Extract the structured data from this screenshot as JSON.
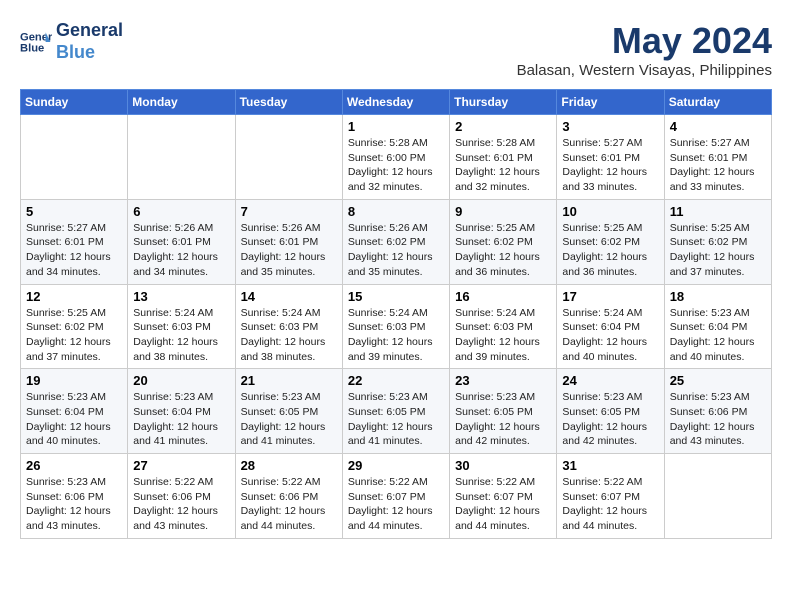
{
  "header": {
    "logo_line1": "General",
    "logo_line2": "Blue",
    "month_title": "May 2024",
    "location": "Balasan, Western Visayas, Philippines"
  },
  "days_of_week": [
    "Sunday",
    "Monday",
    "Tuesday",
    "Wednesday",
    "Thursday",
    "Friday",
    "Saturday"
  ],
  "weeks": [
    [
      {
        "day": "",
        "info": ""
      },
      {
        "day": "",
        "info": ""
      },
      {
        "day": "",
        "info": ""
      },
      {
        "day": "1",
        "info": "Sunrise: 5:28 AM\nSunset: 6:00 PM\nDaylight: 12 hours\nand 32 minutes."
      },
      {
        "day": "2",
        "info": "Sunrise: 5:28 AM\nSunset: 6:01 PM\nDaylight: 12 hours\nand 32 minutes."
      },
      {
        "day": "3",
        "info": "Sunrise: 5:27 AM\nSunset: 6:01 PM\nDaylight: 12 hours\nand 33 minutes."
      },
      {
        "day": "4",
        "info": "Sunrise: 5:27 AM\nSunset: 6:01 PM\nDaylight: 12 hours\nand 33 minutes."
      }
    ],
    [
      {
        "day": "5",
        "info": "Sunrise: 5:27 AM\nSunset: 6:01 PM\nDaylight: 12 hours\nand 34 minutes."
      },
      {
        "day": "6",
        "info": "Sunrise: 5:26 AM\nSunset: 6:01 PM\nDaylight: 12 hours\nand 34 minutes."
      },
      {
        "day": "7",
        "info": "Sunrise: 5:26 AM\nSunset: 6:01 PM\nDaylight: 12 hours\nand 35 minutes."
      },
      {
        "day": "8",
        "info": "Sunrise: 5:26 AM\nSunset: 6:02 PM\nDaylight: 12 hours\nand 35 minutes."
      },
      {
        "day": "9",
        "info": "Sunrise: 5:25 AM\nSunset: 6:02 PM\nDaylight: 12 hours\nand 36 minutes."
      },
      {
        "day": "10",
        "info": "Sunrise: 5:25 AM\nSunset: 6:02 PM\nDaylight: 12 hours\nand 36 minutes."
      },
      {
        "day": "11",
        "info": "Sunrise: 5:25 AM\nSunset: 6:02 PM\nDaylight: 12 hours\nand 37 minutes."
      }
    ],
    [
      {
        "day": "12",
        "info": "Sunrise: 5:25 AM\nSunset: 6:02 PM\nDaylight: 12 hours\nand 37 minutes."
      },
      {
        "day": "13",
        "info": "Sunrise: 5:24 AM\nSunset: 6:03 PM\nDaylight: 12 hours\nand 38 minutes."
      },
      {
        "day": "14",
        "info": "Sunrise: 5:24 AM\nSunset: 6:03 PM\nDaylight: 12 hours\nand 38 minutes."
      },
      {
        "day": "15",
        "info": "Sunrise: 5:24 AM\nSunset: 6:03 PM\nDaylight: 12 hours\nand 39 minutes."
      },
      {
        "day": "16",
        "info": "Sunrise: 5:24 AM\nSunset: 6:03 PM\nDaylight: 12 hours\nand 39 minutes."
      },
      {
        "day": "17",
        "info": "Sunrise: 5:24 AM\nSunset: 6:04 PM\nDaylight: 12 hours\nand 40 minutes."
      },
      {
        "day": "18",
        "info": "Sunrise: 5:23 AM\nSunset: 6:04 PM\nDaylight: 12 hours\nand 40 minutes."
      }
    ],
    [
      {
        "day": "19",
        "info": "Sunrise: 5:23 AM\nSunset: 6:04 PM\nDaylight: 12 hours\nand 40 minutes."
      },
      {
        "day": "20",
        "info": "Sunrise: 5:23 AM\nSunset: 6:04 PM\nDaylight: 12 hours\nand 41 minutes."
      },
      {
        "day": "21",
        "info": "Sunrise: 5:23 AM\nSunset: 6:05 PM\nDaylight: 12 hours\nand 41 minutes."
      },
      {
        "day": "22",
        "info": "Sunrise: 5:23 AM\nSunset: 6:05 PM\nDaylight: 12 hours\nand 41 minutes."
      },
      {
        "day": "23",
        "info": "Sunrise: 5:23 AM\nSunset: 6:05 PM\nDaylight: 12 hours\nand 42 minutes."
      },
      {
        "day": "24",
        "info": "Sunrise: 5:23 AM\nSunset: 6:05 PM\nDaylight: 12 hours\nand 42 minutes."
      },
      {
        "day": "25",
        "info": "Sunrise: 5:23 AM\nSunset: 6:06 PM\nDaylight: 12 hours\nand 43 minutes."
      }
    ],
    [
      {
        "day": "26",
        "info": "Sunrise: 5:23 AM\nSunset: 6:06 PM\nDaylight: 12 hours\nand 43 minutes."
      },
      {
        "day": "27",
        "info": "Sunrise: 5:22 AM\nSunset: 6:06 PM\nDaylight: 12 hours\nand 43 minutes."
      },
      {
        "day": "28",
        "info": "Sunrise: 5:22 AM\nSunset: 6:06 PM\nDaylight: 12 hours\nand 44 minutes."
      },
      {
        "day": "29",
        "info": "Sunrise: 5:22 AM\nSunset: 6:07 PM\nDaylight: 12 hours\nand 44 minutes."
      },
      {
        "day": "30",
        "info": "Sunrise: 5:22 AM\nSunset: 6:07 PM\nDaylight: 12 hours\nand 44 minutes."
      },
      {
        "day": "31",
        "info": "Sunrise: 5:22 AM\nSunset: 6:07 PM\nDaylight: 12 hours\nand 44 minutes."
      },
      {
        "day": "",
        "info": ""
      }
    ]
  ]
}
